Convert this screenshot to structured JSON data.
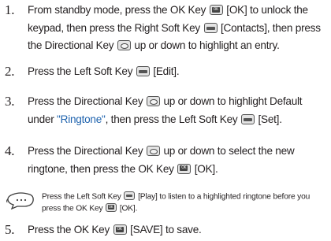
{
  "steps": [
    {
      "number": "1.",
      "parts": {
        "a": "From standby mode, press the OK Key",
        "b": "[OK] to unlock the keypad, then press the Right Soft Key",
        "c": "[Contacts], then press the  Directional Key",
        "d": "up or down to highlight an entry."
      }
    },
    {
      "number": "2.",
      "parts": {
        "a": "Press the Left Soft Key",
        "b": "[Edit]."
      }
    },
    {
      "number": "3.",
      "parts": {
        "a": "Press the Directional Key",
        "b": "up or down to highlight Default under ",
        "c": "\"Ringtone\"",
        "d": ", then press the Left Soft Key",
        "e": "[Set]."
      }
    },
    {
      "number": "4.",
      "parts": {
        "a": "Press the Directional Key",
        "b": "up or down to select the new ringtone, then press the OK Key",
        "c": "[OK]."
      }
    },
    {
      "number": "5.",
      "parts": {
        "a": "Press the OK Key",
        "b": "[SAVE] to save."
      }
    }
  ],
  "note": {
    "icon": "speech-bubble-note-icon",
    "parts": {
      "a": "Press the Left Soft Key",
      "b": "[Play] to listen to a highlighted ringtone before you press the OK Key",
      "c": "[OK]."
    }
  },
  "colors": {
    "text": "#231f20",
    "highlight_blue": "#1f63ae"
  },
  "icons": {
    "ok_key": "ok-key-icon",
    "soft_key": "soft-key-icon",
    "directional_key": "directional-key-icon"
  }
}
